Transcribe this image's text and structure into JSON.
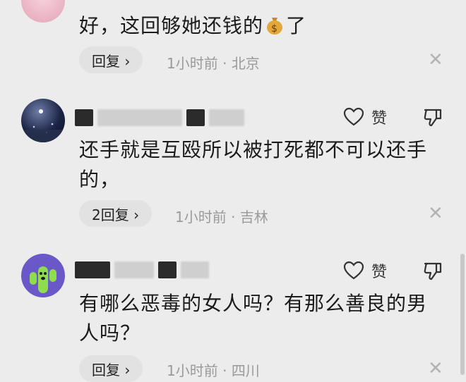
{
  "comments": [
    {
      "text": "好，这回够她还钱的",
      "text_suffix": "了",
      "emoji_icon": "money-bag-icon",
      "reply_label": "回复 ›",
      "time": "1小时前",
      "location": "北京",
      "close": "✕"
    },
    {
      "text": "还手就是互殴所以被打死都不可以还手的，",
      "reply_label": "2回复 ›",
      "time": "1小时前",
      "location": "吉林",
      "like_label": "赞",
      "close": "✕"
    },
    {
      "text": "有哪么恶毒的女人吗？有那么善良的男人吗？",
      "reply_label": "回复 ›",
      "time": "1小时前",
      "location": "四川",
      "like_label": "赞",
      "close": "✕"
    }
  ],
  "meta_separator": "·"
}
